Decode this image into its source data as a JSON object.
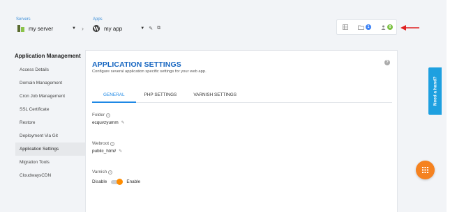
{
  "header": {
    "servers_label": "Servers",
    "server_name": "my server",
    "apps_label": "Apps",
    "app_name": "my app",
    "notifications_count": "1",
    "users_count": "0"
  },
  "sidebar": {
    "title": "Application Management",
    "items": [
      {
        "label": "Access Details"
      },
      {
        "label": "Domain Management"
      },
      {
        "label": "Cron Job Management"
      },
      {
        "label": "SSL Certificate"
      },
      {
        "label": "Restore"
      },
      {
        "label": "Deployment Via Git"
      },
      {
        "label": "Application Settings",
        "active": true
      },
      {
        "label": "Migration Tools"
      },
      {
        "label": "CloudwaysCDN"
      }
    ]
  },
  "main": {
    "title": "APPLICATION SETTINGS",
    "subtitle": "Configure several application specific settings for your web app.",
    "tabs": [
      {
        "label": "GENERAL",
        "active": true
      },
      {
        "label": "PHP SETTINGS"
      },
      {
        "label": "VARNISH SETTINGS"
      }
    ],
    "folder": {
      "label": "Folder",
      "value": "ecquvzyumm"
    },
    "webroot": {
      "label": "Webroot",
      "value": "public_html/"
    },
    "varnish": {
      "label": "Varnish",
      "off_label": "Disable",
      "on_label": "Enable",
      "enabled": true
    }
  },
  "help_tab": {
    "label": "Need a hand?"
  },
  "colors": {
    "accent_blue": "#1e88e5",
    "title_blue": "#1565c0",
    "orange": "#f58220",
    "help_blue": "#1ea0e0",
    "badge_blue": "#3b82f6",
    "badge_green": "#7cc243",
    "arrow_red": "#e02020"
  },
  "icons": [
    "server-icon",
    "wordpress-icon",
    "pencil-icon",
    "external-link-icon",
    "list-icon",
    "folder-icon",
    "user-icon",
    "info-icon",
    "help-icon",
    "grid-icon"
  ]
}
